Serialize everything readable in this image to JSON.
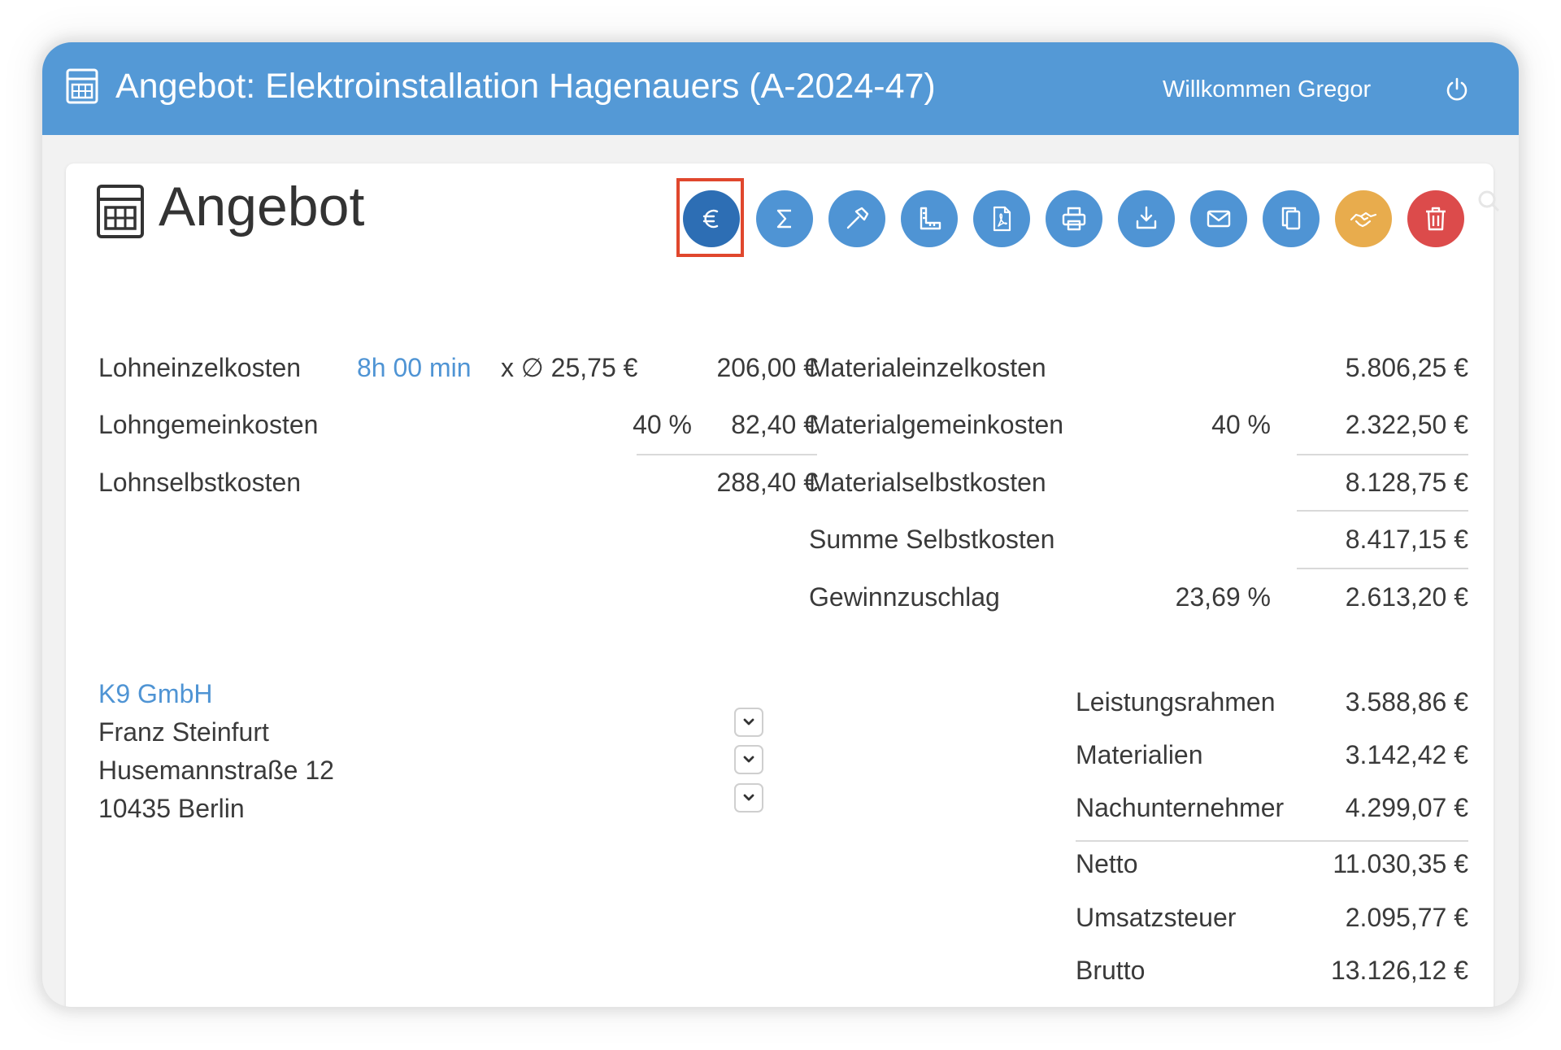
{
  "window": {
    "title": "Angebot: Elektroinstallation Hagenauers (A-2024-47)",
    "welcome": "Willkommen Gregor",
    "header_color": "#5499d6"
  },
  "page": {
    "heading": "Angebot"
  },
  "toolbar": [
    {
      "name": "euro-button",
      "icon": "euro-icon",
      "active": true,
      "color": "#2d6eb4"
    },
    {
      "name": "sum-button",
      "icon": "sigma-icon",
      "color": "#4f94d4"
    },
    {
      "name": "hammer-button",
      "icon": "hammer-icon",
      "color": "#4f94d4"
    },
    {
      "name": "measure-button",
      "icon": "ruler-icon",
      "color": "#4f94d4"
    },
    {
      "name": "pdf-button",
      "icon": "pdf-icon",
      "color": "#4f94d4"
    },
    {
      "name": "print-button",
      "icon": "printer-icon",
      "color": "#4f94d4"
    },
    {
      "name": "download-button",
      "icon": "download-icon",
      "color": "#4f94d4"
    },
    {
      "name": "email-button",
      "icon": "envelope-icon",
      "color": "#4f94d4"
    },
    {
      "name": "copy-button",
      "icon": "copy-icon",
      "color": "#4f94d4"
    },
    {
      "name": "handshake-button",
      "icon": "handshake-icon",
      "color": "#e8ac4d"
    },
    {
      "name": "delete-button",
      "icon": "trash-icon",
      "color": "#dc4b4b"
    }
  ],
  "labor": {
    "einzel": {
      "label": "Lohneinzelkosten",
      "time": "8h 00 min",
      "rate": "x ∅ 25,75 €",
      "value": "206,00 €"
    },
    "gemein": {
      "label": "Lohngemeinkosten",
      "pct": "40 %",
      "value": "82,40 €"
    },
    "selbst": {
      "label": "Lohnselbstkosten",
      "value": "288,40 €"
    }
  },
  "material": {
    "einzel": {
      "label": "Materialeinzelkosten",
      "value": "5.806,25 €"
    },
    "gemein": {
      "label": "Materialgemeinkosten",
      "pct": "40 %",
      "value": "2.322,50 €"
    },
    "selbst": {
      "label": "Materialselbstkosten",
      "value": "8.128,75 €"
    },
    "summe": {
      "label": "Summe Selbstkosten",
      "value": "8.417,15 €"
    },
    "gewinn": {
      "label": "Gewinnzuschlag",
      "pct": "23,69 %",
      "value": "2.613,20 €"
    }
  },
  "customer": {
    "company": "K9 GmbH",
    "contact": "Franz Steinfurt",
    "street": "Husemannstraße 12",
    "city": "10435 Berlin"
  },
  "summary": {
    "leistung": {
      "label": "Leistungsrahmen",
      "value": "3.588,86 €"
    },
    "materialien": {
      "label": "Materialien",
      "value": "3.142,42 €"
    },
    "nachunternehmer": {
      "label": "Nachunternehmer",
      "value": "4.299,07 €"
    },
    "netto": {
      "label": "Netto",
      "value": "11.030,35 €"
    },
    "ust": {
      "label": "Umsatzsteuer",
      "value": "2.095,77 €"
    },
    "brutto": {
      "label": "Brutto",
      "value": "13.126,12 €"
    }
  }
}
